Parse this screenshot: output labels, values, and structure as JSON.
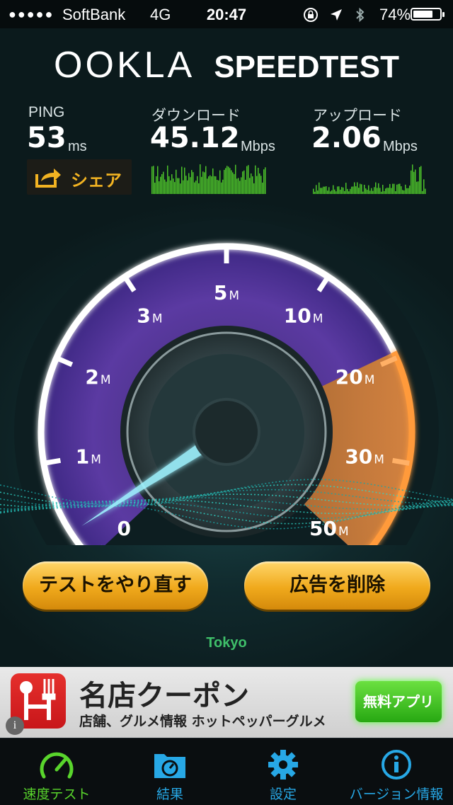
{
  "status_bar": {
    "signal": "●●●●●",
    "carrier": "SoftBank",
    "network": "4G",
    "time": "20:47",
    "battery_percent": "74%",
    "battery_level": 0.74
  },
  "header": {
    "logo_primary": "OOKLA",
    "logo_secondary": "SPEEDTEST"
  },
  "metrics": {
    "ping": {
      "label": "PING",
      "value": "53",
      "unit": "ms"
    },
    "download": {
      "label": "ダウンロード",
      "value": "45.12",
      "unit": "Mbps"
    },
    "upload": {
      "label": "アップロード",
      "value": "2.06",
      "unit": "Mbps"
    }
  },
  "share": {
    "label": "シェア"
  },
  "gauge": {
    "ticks": [
      {
        "num": "0",
        "unit": ""
      },
      {
        "num": "1",
        "unit": "M"
      },
      {
        "num": "2",
        "unit": "M"
      },
      {
        "num": "3",
        "unit": "M"
      },
      {
        "num": "5",
        "unit": "M"
      },
      {
        "num": "10",
        "unit": "M"
      },
      {
        "num": "20",
        "unit": "M"
      },
      {
        "num": "30",
        "unit": "M"
      },
      {
        "num": "50",
        "unit": "M"
      }
    ],
    "needle_value": "0"
  },
  "buttons": {
    "retest": "テストをやり直す",
    "remove_ads": "広告を削除"
  },
  "server": "Tokyo",
  "ad": {
    "title": "名店クーポン",
    "subtitle": "店舗、グルメ情報 ホットペッパーグルメ",
    "cta": "無料アプリ",
    "info": "i"
  },
  "tabs": [
    {
      "label": "速度テスト",
      "icon": "speedometer-icon",
      "active": true
    },
    {
      "label": "結果",
      "icon": "results-folder-icon",
      "active": false
    },
    {
      "label": "設定",
      "icon": "gear-icon",
      "active": false
    },
    {
      "label": "バージョン情報",
      "icon": "info-icon",
      "active": false
    }
  ],
  "colors": {
    "accent_orange": "#f0a91c",
    "tab_active": "#59d52c",
    "tab_inactive": "#27a8e6",
    "server_text": "#3fc06a"
  }
}
